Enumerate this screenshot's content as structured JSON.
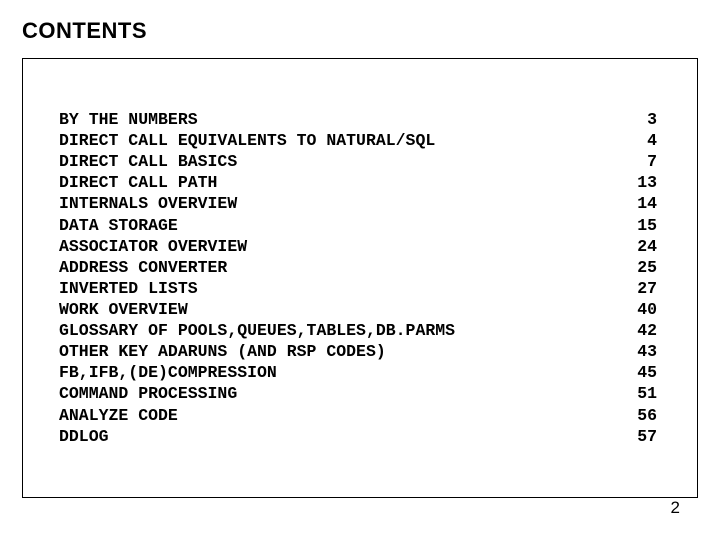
{
  "heading": "CONTENTS",
  "toc": [
    {
      "title": "BY THE NUMBERS",
      "page": "3"
    },
    {
      "title": "DIRECT CALL EQUIVALENTS TO NATURAL/SQL",
      "page": "4"
    },
    {
      "title": "DIRECT CALL BASICS",
      "page": "7"
    },
    {
      "title": "DIRECT CALL PATH",
      "page": "13"
    },
    {
      "title": "INTERNALS OVERVIEW",
      "page": "14"
    },
    {
      "title": "DATA STORAGE",
      "page": "15"
    },
    {
      "title": "ASSOCIATOR OVERVIEW",
      "page": "24"
    },
    {
      "title": "ADDRESS CONVERTER",
      "page": "25"
    },
    {
      "title": "INVERTED LISTS",
      "page": "27"
    },
    {
      "title": "WORK OVERVIEW",
      "page": "40"
    },
    {
      "title": "GLOSSARY OF POOLS,QUEUES,TABLES,DB.PARMS",
      "page": "42"
    },
    {
      "title": "OTHER KEY ADARUNS (AND RSP CODES)",
      "page": "43"
    },
    {
      "title": "FB,IFB,(DE)COMPRESSION",
      "page": "45"
    },
    {
      "title": "COMMAND PROCESSING",
      "page": "51"
    },
    {
      "title": "ANALYZE CODE",
      "page": "56"
    },
    {
      "title": "DDLOG",
      "page": "57"
    }
  ],
  "page_number": "2"
}
